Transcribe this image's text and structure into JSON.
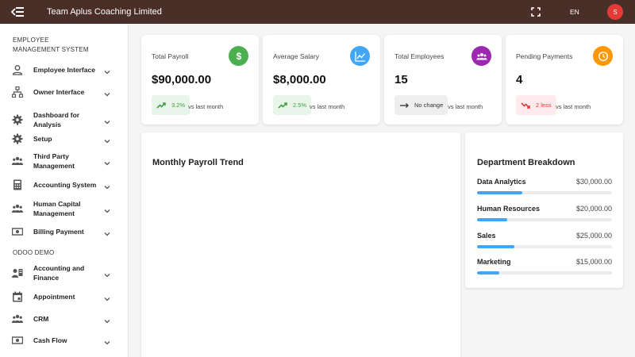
{
  "topbar": {
    "title": "Team Aplus Coaching Limited",
    "language": "EN",
    "avatar_initial": "S"
  },
  "sidebar": {
    "sections": [
      {
        "title": "EMPLOYEE MANAGEMENT SYSTEM",
        "items": [
          {
            "label": "Employee Interface",
            "icon": "person-icon"
          },
          {
            "label": "Owner Interface",
            "icon": "org-chart-icon"
          },
          {
            "label": "Dashboard for Analysis",
            "icon": "gear-icon"
          },
          {
            "label": "Setup",
            "icon": "gear-icon"
          },
          {
            "label": "Third Party Management",
            "icon": "group-icon"
          },
          {
            "label": "Accounting System",
            "icon": "calculator-icon"
          },
          {
            "label": "Human Capital Management",
            "icon": "group-icon"
          },
          {
            "label": "Billing Payment",
            "icon": "money-icon"
          }
        ]
      },
      {
        "title": "ODOO DEMO",
        "items": [
          {
            "label": "Accounting and Finance",
            "icon": "contacts-icon"
          },
          {
            "label": "Appointment",
            "icon": "calendar-icon"
          },
          {
            "label": "CRM",
            "icon": "group-icon"
          },
          {
            "label": "Cash Flow",
            "icon": "money-icon"
          }
        ]
      }
    ]
  },
  "stats": [
    {
      "label": "Total Payroll",
      "value": "$90,000.00",
      "change": "3.2%",
      "trend": "up",
      "vs": "vs last month",
      "icon": "dollar-icon",
      "color": "#4caf50"
    },
    {
      "label": "Average Salary",
      "value": "$8,000.00",
      "change": "2.5%",
      "trend": "up",
      "vs": "vs last month",
      "icon": "chart-line-icon",
      "color": "#42a5f5"
    },
    {
      "label": "Total Employees",
      "value": "15",
      "change": "No change",
      "trend": "flat",
      "vs": "vs last month",
      "icon": "group-icon",
      "color": "#9c27b0"
    },
    {
      "label": "Pending Payments",
      "value": "4",
      "change": "2 less",
      "trend": "down",
      "vs": "vs last month",
      "icon": "clock-icon",
      "color": "#ff9800"
    }
  ],
  "trend_panel": {
    "title": "Monthly Payroll Trend"
  },
  "department_panel": {
    "title": "Department Breakdown",
    "departments": [
      {
        "name": "Data Analytics",
        "amount": "$30,000.00",
        "share": 0.333
      },
      {
        "name": "Human Resources",
        "amount": "$20,000.00",
        "share": 0.222
      },
      {
        "name": "Sales",
        "amount": "$25,000.00",
        "share": 0.278
      },
      {
        "name": "Marketing",
        "amount": "$15,000.00",
        "share": 0.167
      }
    ]
  },
  "colors": {
    "topbar": "#4a2e28",
    "up_chip_bg": "#e8f5e9",
    "up_text": "#43a047",
    "flat_chip_bg": "#eeeeee",
    "down_chip_bg": "#ffebee",
    "down_text": "#e53935",
    "bar_fill": "#42a5f5"
  }
}
